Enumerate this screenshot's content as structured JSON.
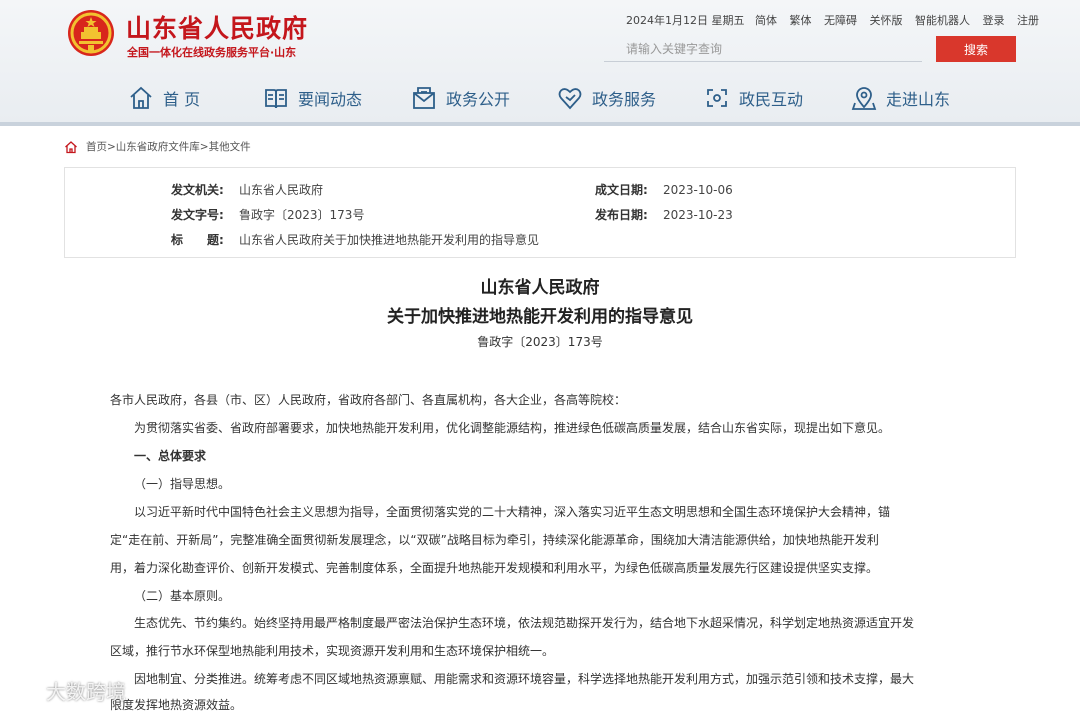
{
  "header": {
    "site_title": "山东省人民政府",
    "site_subtitle": "全国一体化在线政务服务平台·山东",
    "date": "2024年1月12日 星期五",
    "top_links": [
      "简体",
      "繁体",
      "无障碍",
      "关怀版",
      "智能机器人",
      "登录",
      "注册"
    ],
    "search_placeholder": "请输入关键字查询",
    "search_button": "搜索",
    "brand_color": "#c4161c"
  },
  "nav": [
    {
      "label": "首 页",
      "icon": "home-icon"
    },
    {
      "label": "要闻动态",
      "icon": "book-icon"
    },
    {
      "label": "政务公开",
      "icon": "mail-icon"
    },
    {
      "label": "政务服务",
      "icon": "heart-icon"
    },
    {
      "label": "政民互动",
      "icon": "interaction-icon"
    },
    {
      "label": "走进山东",
      "icon": "location-icon"
    }
  ],
  "breadcrumb": "首页>山东省政府文件库>其他文件",
  "meta": {
    "issuer_label": "发文机关:",
    "issuer": "山东省人民政府",
    "doc_no_label": "发文字号:",
    "doc_no": "鲁政字〔2023〕173号",
    "subject_label": "标　　题:",
    "subject": "山东省人民政府关于加快推进地热能开发利用的指导意见",
    "created_label": "成文日期:",
    "created": "2023-10-06",
    "published_label": "发布日期:",
    "published": "2023-10-23"
  },
  "document": {
    "title_line1": "山东省人民政府",
    "title_line2": "关于加快推进地热能开发利用的指导意见",
    "doc_no": "鲁政字〔2023〕173号",
    "recipients": "各市人民政府，各县（市、区）人民政府，省政府各部门、各直属机构，各大企业，各高等院校：",
    "intro": "为贯彻落实省委、省政府部署要求，加快地热能开发利用，优化调整能源结构，推进绿色低碳高质量发展，结合山东省实际，现提出如下意见。",
    "section1": "一、总体要求",
    "sub1": "（一）指导思想。",
    "para1_line1": "以习近平新时代中国特色社会主义思想为指导，全面贯彻落实党的二十大精神，深入落实习近平生态文明思想和全国生态环境保护大会精神，锚",
    "para1_line2": "定“走在前、开新局”，完整准确全面贯彻新发展理念，以“双碳”战略目标为牵引，持续深化能源革命，围绕加大清洁能源供给，加快地热能开发利",
    "para1_line3": "用，着力深化勘查评价、创新开发模式、完善制度体系，全面提升地热能开发规模和利用水平，为绿色低碳高质量发展先行区建设提供坚实支撑。",
    "sub2": "（二）基本原则。",
    "para2_line1": "生态优先、节约集约。始终坚持用最严格制度最严密法治保护生态环境，依法规范勘探开发行为，结合地下水超采情况，科学划定地热资源适宜开发",
    "para2_line2": "区域，推行节水环保型地热能利用技术，实现资源开发利用和生态环境保护相统一。",
    "para3_line1": "因地制宜、分类推进。统筹考虑不同区域地热资源禀赋、用能需求和资源环境容量，科学选择地热能开发利用方式，加强示范引领和技术支撑，最大",
    "para3_line2": "限度发挥地热资源效益。"
  },
  "watermark": "大数跨境"
}
